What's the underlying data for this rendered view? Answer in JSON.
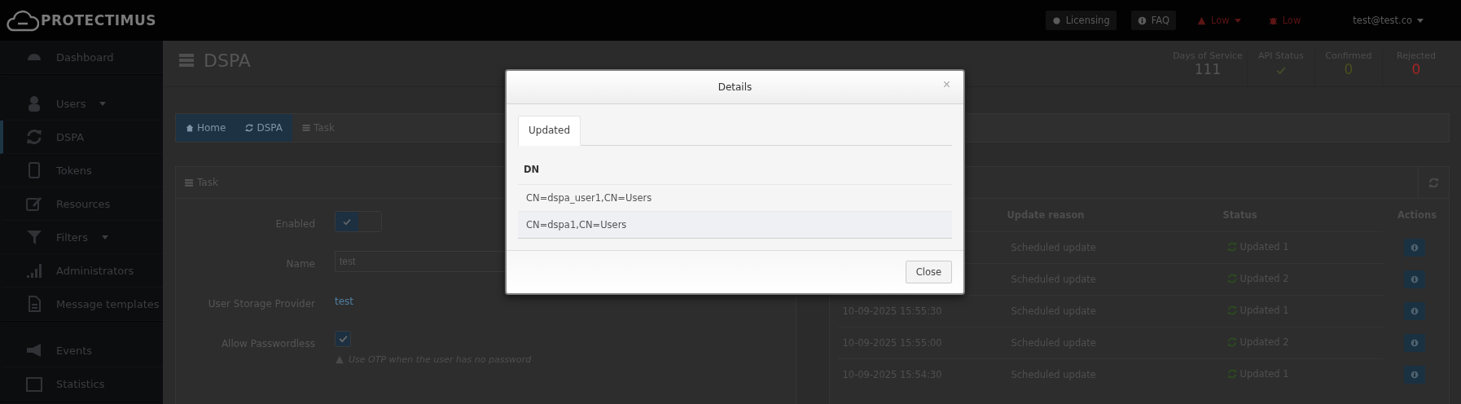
{
  "top_bar": {
    "logo": "PROTECTIMUS",
    "items": [
      {
        "label": "Licensing",
        "alert": false,
        "caret": false
      },
      {
        "label": "FAQ",
        "alert": false,
        "caret": false
      },
      {
        "label": "Low",
        "alert": true,
        "caret": true
      },
      {
        "label": "Low",
        "alert": true,
        "caret": false
      },
      {
        "label": "test@test.co",
        "alert": false,
        "caret": true
      }
    ]
  },
  "sidebar": {
    "groups": [
      [
        {
          "label": "Dashboard",
          "selected": false,
          "caret": false
        }
      ],
      [
        {
          "label": "Users",
          "selected": false,
          "caret": true
        },
        {
          "label": "DSPA",
          "selected": true,
          "caret": false
        },
        {
          "label": "Tokens",
          "selected": false,
          "caret": false
        },
        {
          "label": "Resources",
          "selected": false,
          "caret": false
        },
        {
          "label": "Filters",
          "selected": false,
          "caret": true
        },
        {
          "label": "Administrators",
          "selected": false,
          "caret": false
        },
        {
          "label": "Message templates",
          "selected": false,
          "caret": false
        }
      ],
      [
        {
          "label": "Events",
          "selected": false,
          "caret": false
        },
        {
          "label": "Statistics",
          "selected": false,
          "caret": false
        }
      ]
    ]
  },
  "page": {
    "title": "DSPA",
    "stats": [
      {
        "label": "Days of Service",
        "kind": "number",
        "value": "111",
        "color": "#555555"
      },
      {
        "label": "API Status",
        "kind": "check",
        "color": "#3f4a2a"
      },
      {
        "label": "Confirmed",
        "kind": "number",
        "value": "0",
        "color": "#4a4f1c"
      },
      {
        "label": "Rejected",
        "kind": "number",
        "value": "0",
        "color": "#a52424"
      }
    ]
  },
  "breadcrumb": [
    {
      "label": "Home",
      "current": false
    },
    {
      "label": "DSPA",
      "current": false
    },
    {
      "label": "Task",
      "current": true
    }
  ],
  "task_panel": {
    "title": "Task",
    "enabled": {
      "label": "Enabled",
      "on": true
    },
    "name": {
      "label": "Name",
      "value": "test"
    },
    "storage": {
      "label": "User Storage Provider",
      "value": "test"
    },
    "passwordless": {
      "label": "Allow Passwordless",
      "checked": true,
      "hint": "Use OTP when the user has no password"
    }
  },
  "history_table": {
    "columns": [
      "Update reason",
      "Status",
      "Actions"
    ],
    "rows": [
      {
        "reason": "Scheduled update",
        "status": "Updated 1"
      },
      {
        "reason": "Scheduled update",
        "status": "Updated 2"
      },
      {
        "date": "10-09-2025 15:55:30",
        "reason": "Scheduled update",
        "status": "Updated 1"
      },
      {
        "date": "10-09-2025 15:55:00",
        "reason": "Scheduled update",
        "status": "Updated 2"
      },
      {
        "date": "10-09-2025 15:54:30",
        "reason": "Scheduled update",
        "status": "Updated 1"
      }
    ]
  },
  "modal": {
    "title": "Details",
    "close_glyph": "×",
    "tabs": [
      {
        "label": "Updated",
        "selected": true
      }
    ],
    "column": "DN",
    "rows": [
      "CN=dspa_user1,CN=Users",
      "CN=dspa1,CN=Users"
    ],
    "button": "Close"
  }
}
